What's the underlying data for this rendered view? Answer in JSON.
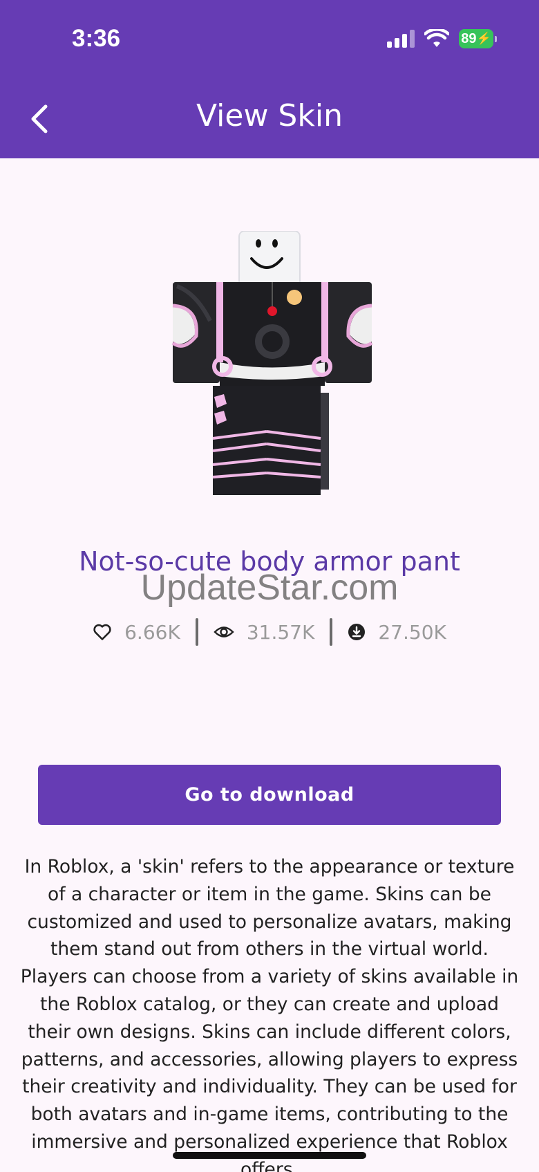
{
  "status_bar": {
    "time": "3:36",
    "battery": "89",
    "icons": [
      "signal-icon",
      "wifi-icon",
      "battery-icon"
    ]
  },
  "header": {
    "title": "View Skin",
    "back_icon": "chevron-left-icon"
  },
  "skin": {
    "name": "Not-so-cute body armor pant",
    "image_alt": "Roblox avatar wearing black and pink body armor pants"
  },
  "watermark": "UpdateStar.com",
  "stats": {
    "likes": "6.66K",
    "views": "31.57K",
    "downloads": "27.50K"
  },
  "actions": {
    "download_label": "Go to download"
  },
  "description": "In Roblox, a 'skin' refers to the appearance or texture of a character or item in the game. Skins can be customized and used to personalize avatars, making them stand out from others in the virtual world. Players can choose from a variety of skins available in the Roblox catalog, or they can create and upload their own designs. Skins can include different colors, patterns, and accessories, allowing players to express their creativity and individuality. They can be used for both avatars and in-game items, contributing to the immersive and personalized experience that Roblox offers.",
  "colors": {
    "primary": "#663cb4",
    "title_text": "#5b3aa6",
    "background": "#fdf6fc",
    "stat_text": "#9a9a9a"
  }
}
